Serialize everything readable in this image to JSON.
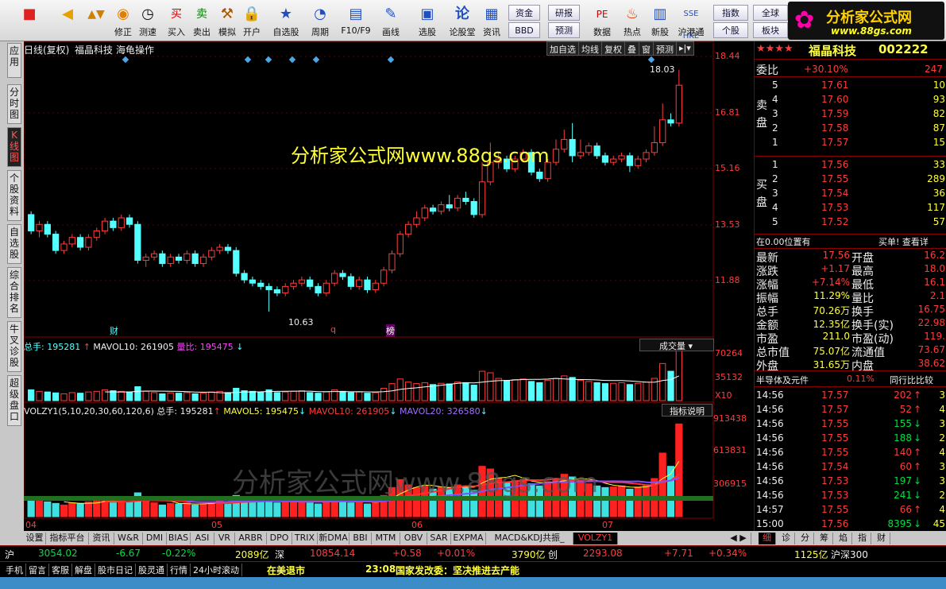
{
  "toolbar": {
    "buttons": [
      "",
      "",
      "修正",
      "测速",
      "买入",
      "卖出",
      "模拟",
      "开户",
      "自选股",
      "周期",
      "F10/F9",
      "画线",
      "选股",
      "论股堂",
      "资讯",
      "数据",
      "热点",
      "新股",
      "沪港通"
    ],
    "small": [
      "资金",
      "BBD",
      "研报",
      "预测",
      "指数",
      "个股",
      "全球",
      "板块"
    ]
  },
  "logo": {
    "line1": "分析家公式网",
    "line2": "www.88gs.com"
  },
  "leftnav": [
    "应用",
    "分时图",
    "K线图",
    "个股资料",
    "自选股",
    "综合排名",
    "牛叉诊股",
    "超级盘口"
  ],
  "chart": {
    "header_left": "日线(复权)",
    "stock_name": "福晶科技",
    "indicator_name": "海龟操作",
    "buttons": [
      "加自选",
      "均线",
      "复权",
      "叠",
      "窗",
      "预测"
    ],
    "price_axis": [
      "18.44",
      "16.81",
      "15.16",
      "13.53",
      "11.88"
    ],
    "high_label": "18.03",
    "low_label": "10.63",
    "markers": [
      "财",
      "q",
      "榜"
    ],
    "watermark1": "分析家公式网www.88gs.com",
    "watermark2": "分析家公式网www.88gs.com",
    "vol_header": {
      "total": "总手: 195281",
      "mavol10": "MAVOL10: 261905",
      "ratio": "量比: 195475"
    },
    "vol_dropdown": "成交量",
    "vol_axis": [
      "70264",
      "35132",
      "X10"
    ],
    "volzy_header": {
      "name": "VOLZY1(5,10,20,30,60,120,6)",
      "total": "总手: 195281",
      "mavol5": "MAVOL5: 195475",
      "mavol10": "MAVOL10: 261905",
      "mavol20": "MAVOL20: 326580"
    },
    "volzy_button": "指标说明",
    "volzy_axis": [
      "913438",
      "613831",
      "306915"
    ],
    "months": [
      "04",
      "05",
      "06",
      "07"
    ]
  },
  "chart_data": {
    "type": "candlestick",
    "candles": [
      [
        13.6,
        13.1,
        13.7,
        13.0
      ],
      [
        13.1,
        13.3,
        13.4,
        12.9
      ],
      [
        13.3,
        13.0,
        13.4,
        12.9
      ],
      [
        13.0,
        12.5,
        13.1,
        12.4
      ],
      [
        12.5,
        12.7,
        12.8,
        12.4
      ],
      [
        12.7,
        12.9,
        13.0,
        12.6
      ],
      [
        12.9,
        12.6,
        13.0,
        12.5
      ],
      [
        12.6,
        12.9,
        13.0,
        12.5
      ],
      [
        12.9,
        13.1,
        13.2,
        12.8
      ],
      [
        13.1,
        13.4,
        13.5,
        13.0
      ],
      [
        13.4,
        13.2,
        13.5,
        13.1
      ],
      [
        13.2,
        13.5,
        13.6,
        13.1
      ],
      [
        13.5,
        13.3,
        13.6,
        13.2
      ],
      [
        13.3,
        12.2,
        13.4,
        12.1
      ],
      [
        12.2,
        12.3,
        12.4,
        12.0
      ],
      [
        12.3,
        12.4,
        12.5,
        12.2
      ],
      [
        12.4,
        12.1,
        12.5,
        12.0
      ],
      [
        12.1,
        12.3,
        12.4,
        12.0
      ],
      [
        12.3,
        12.2,
        12.4,
        12.1
      ],
      [
        12.2,
        12.4,
        12.5,
        12.1
      ],
      [
        12.4,
        12.1,
        12.5,
        12.0
      ],
      [
        12.1,
        12.3,
        12.4,
        12.0
      ],
      [
        12.3,
        12.5,
        12.6,
        12.2
      ],
      [
        12.5,
        12.6,
        12.7,
        12.4
      ],
      [
        12.6,
        12.5,
        12.7,
        12.4
      ],
      [
        12.5,
        11.8,
        12.6,
        11.7
      ],
      [
        11.8,
        11.6,
        11.9,
        11.5
      ],
      [
        11.6,
        11.5,
        11.7,
        11.4
      ],
      [
        11.5,
        11.4,
        11.6,
        11.3
      ],
      [
        11.4,
        11.3,
        11.5,
        10.63
      ],
      [
        11.3,
        11.2,
        11.4,
        11.1
      ],
      [
        11.2,
        11.4,
        11.5,
        11.1
      ],
      [
        11.4,
        11.5,
        11.6,
        11.3
      ],
      [
        11.5,
        11.6,
        11.7,
        11.4
      ],
      [
        11.6,
        11.4,
        11.7,
        11.3
      ],
      [
        11.4,
        11.2,
        11.5,
        11.1
      ],
      [
        11.2,
        11.5,
        11.6,
        11.1
      ],
      [
        11.5,
        11.8,
        11.9,
        11.4
      ],
      [
        11.8,
        11.7,
        11.9,
        11.6
      ],
      [
        11.7,
        11.4,
        11.8,
        11.3
      ],
      [
        11.4,
        11.6,
        11.7,
        11.3
      ],
      [
        11.6,
        11.3,
        11.7,
        11.2
      ],
      [
        11.3,
        11.5,
        11.6,
        11.2
      ],
      [
        11.5,
        11.9,
        12.0,
        11.4
      ],
      [
        11.9,
        12.4,
        12.5,
        11.8
      ],
      [
        12.4,
        13.0,
        13.1,
        12.3
      ],
      [
        13.0,
        13.3,
        13.4,
        12.9
      ],
      [
        13.3,
        13.5,
        13.7,
        13.2
      ],
      [
        13.5,
        13.8,
        13.9,
        13.4
      ],
      [
        13.8,
        13.7,
        13.9,
        13.6
      ],
      [
        13.7,
        13.9,
        14.0,
        13.6
      ],
      [
        13.9,
        13.8,
        14.2,
        13.7
      ],
      [
        13.8,
        14.1,
        14.2,
        13.7
      ],
      [
        14.1,
        14.0,
        14.3,
        13.9
      ],
      [
        14.0,
        13.6,
        14.1,
        13.5
      ],
      [
        13.6,
        14.6,
        15.2,
        13.5
      ],
      [
        14.6,
        15.2,
        15.8,
        14.5
      ],
      [
        15.2,
        15.3,
        15.5,
        15.0
      ],
      [
        15.3,
        15.0,
        15.4,
        14.9
      ],
      [
        15.0,
        15.3,
        15.4,
        14.9
      ],
      [
        15.3,
        15.5,
        15.6,
        15.2
      ],
      [
        15.5,
        14.9,
        15.6,
        14.8
      ],
      [
        14.9,
        14.7,
        15.0,
        14.6
      ],
      [
        14.7,
        15.2,
        15.3,
        14.6
      ],
      [
        15.2,
        15.6,
        15.9,
        15.1
      ],
      [
        15.6,
        15.9,
        16.2,
        15.5
      ],
      [
        15.9,
        15.4,
        16.4,
        15.2
      ],
      [
        15.4,
        15.5,
        15.9,
        15.3
      ],
      [
        15.5,
        15.7,
        15.8,
        15.4
      ],
      [
        15.7,
        15.4,
        15.8,
        15.3
      ],
      [
        15.4,
        15.2,
        15.5,
        15.1
      ],
      [
        15.2,
        15.3,
        15.4,
        15.1
      ],
      [
        15.3,
        15.4,
        15.5,
        15.2
      ],
      [
        15.4,
        15.1,
        15.5,
        14.9
      ],
      [
        15.1,
        15.3,
        15.4,
        15.0
      ],
      [
        15.3,
        15.5,
        15.6,
        15.2
      ],
      [
        15.5,
        15.8,
        16.3,
        15.4
      ],
      [
        15.8,
        16.5,
        17.0,
        15.7
      ],
      [
        16.5,
        16.4,
        16.7,
        16.3
      ],
      [
        16.4,
        17.56,
        18.03,
        16.3
      ]
    ],
    "volume": [
      35,
      30,
      28,
      25,
      22,
      26,
      24,
      28,
      30,
      35,
      32,
      30,
      28,
      45,
      30,
      26,
      22,
      25,
      24,
      26,
      22,
      24,
      28,
      30,
      26,
      40,
      32,
      30,
      28,
      35,
      26,
      28,
      30,
      32,
      26,
      24,
      28,
      35,
      30,
      26,
      28,
      24,
      26,
      40,
      55,
      70,
      60,
      55,
      58,
      52,
      56,
      54,
      60,
      58,
      50,
      95,
      90,
      72,
      65,
      68,
      70,
      62,
      58,
      66,
      72,
      80,
      75,
      66,
      62,
      58,
      55,
      56,
      58,
      52,
      56,
      60,
      72,
      120,
      95,
      175
    ],
    "y_range": [
      10.63,
      18.44
    ]
  },
  "rp": {
    "stars": "★★★★",
    "name": "福晶科技",
    "code": "002222",
    "webi": {
      "label": "委比",
      "pct": "+30.10%",
      "val": "247"
    },
    "sell": [
      {
        "n": "5",
        "p": "17.61",
        "v": "10"
      },
      {
        "n": "4",
        "p": "17.60",
        "v": "93"
      },
      {
        "n": "3",
        "p": "17.59",
        "v": "82"
      },
      {
        "n": "2",
        "p": "17.58",
        "v": "87"
      },
      {
        "n": "1",
        "p": "17.57",
        "v": "15"
      }
    ],
    "buy": [
      {
        "n": "1",
        "p": "17.56",
        "v": "33"
      },
      {
        "n": "2",
        "p": "17.55",
        "v": "289"
      },
      {
        "n": "3",
        "p": "17.54",
        "v": "36"
      },
      {
        "n": "4",
        "p": "17.53",
        "v": "117"
      },
      {
        "n": "5",
        "p": "17.52",
        "v": "57"
      }
    ],
    "sell_label": "卖盘",
    "buy_label": "买盘",
    "pos_text": "在0.00位置有",
    "pos_right": "买单! 查看详",
    "quotes": [
      [
        "最新",
        "17.56",
        "开盘",
        "16.2"
      ],
      [
        "涨跌",
        "+1.17",
        "最高",
        "18.0"
      ],
      [
        "涨幅",
        "+7.14%",
        "最低",
        "16.1"
      ],
      [
        "振幅",
        "11.29%",
        "量比",
        "2.1"
      ],
      [
        "总手",
        "70.26万",
        "换手",
        "16.75"
      ],
      [
        "金额",
        "12.35亿",
        "换手(实)",
        "22.98"
      ],
      [
        "市盈",
        "211.0",
        "市盈(动)",
        "119."
      ],
      [
        "总市值",
        "75.07亿",
        "流通值",
        "73.67"
      ],
      [
        "外盘",
        "31.65万",
        "内盘",
        "38.62"
      ]
    ],
    "sector": "半导体及元件",
    "sector_pct": "0.11%",
    "compare": "同行比比较",
    "ticks": [
      [
        "14:56",
        "17.57",
        "202",
        "↑",
        "3"
      ],
      [
        "14:56",
        "17.57",
        "52",
        "↑",
        "4"
      ],
      [
        "14:56",
        "17.55",
        "155",
        "↓",
        "3"
      ],
      [
        "14:56",
        "17.55",
        "188",
        "↓",
        "2"
      ],
      [
        "14:56",
        "17.55",
        "140",
        "↑",
        "4"
      ],
      [
        "14:56",
        "17.54",
        "60",
        "↑",
        "3"
      ],
      [
        "14:56",
        "17.53",
        "197",
        "↓",
        "3"
      ],
      [
        "14:56",
        "17.53",
        "241",
        "↓",
        "2"
      ],
      [
        "14:57",
        "17.55",
        "66",
        "↑",
        "4"
      ],
      [
        "15:00",
        "17.56",
        "8395",
        "↓",
        "45"
      ]
    ]
  },
  "bottomtabs": [
    "设置",
    "指标平台",
    "资讯",
    "W&R",
    "DMI",
    "BIAS",
    "ASI",
    "VR",
    "ARBR",
    "DPO",
    "TRIX",
    "新DMA",
    "BBI",
    "MTM",
    "OBV",
    "SAR",
    "EXPMA",
    "MACD&KDJ共振_",
    "VOLZY1"
  ],
  "rtabs": [
    "细",
    "诊",
    "分",
    "筹",
    "焰",
    "指",
    "财"
  ],
  "status1": {
    "sh": "沪",
    "sh_idx": "3054.02",
    "sh_chg": "-6.67",
    "sh_pct": "-0.22%",
    "sh_amt": "2089亿",
    "sz": "深",
    "sz_idx": "10854.14",
    "sz_chg": "+0.58",
    "sz_pct": "+0.01%",
    "sz_amt": "3790亿",
    "cy": "创",
    "cy_idx": "2293.08",
    "cy_chg": "+7.71",
    "cy_pct": "+0.34%",
    "cy_amt": "1125亿",
    "hs": "沪深300"
  },
  "status2": {
    "items": [
      "手机",
      "留言",
      "客服",
      "解盘",
      "股市日记",
      "股灵通",
      "行情",
      "24小时滚动"
    ],
    "news1": "在美退市",
    "time": "23:08",
    "news2": "国家发改委：坚决推进去产能"
  }
}
